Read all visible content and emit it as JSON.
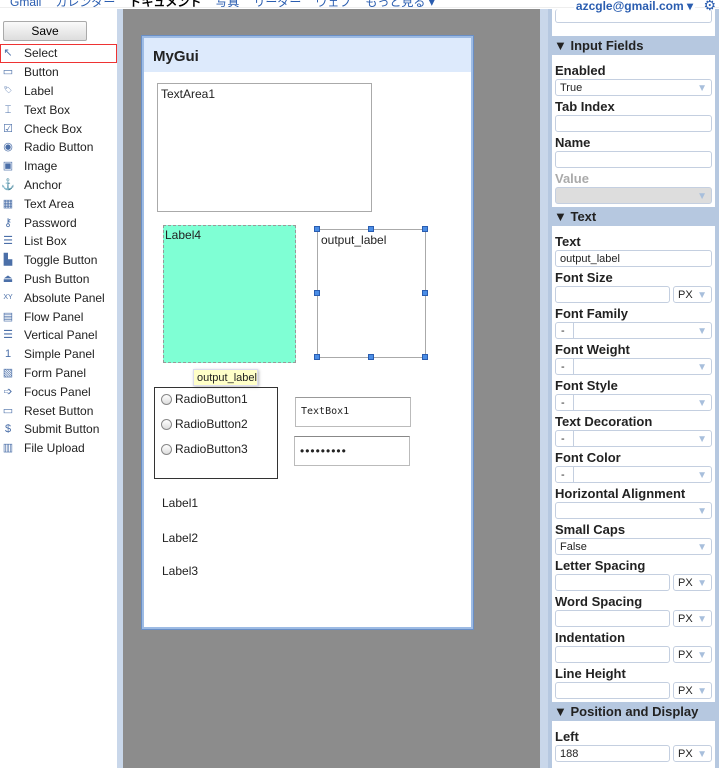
{
  "topbar": {
    "nav": [
      "Gmail",
      "カレンダー",
      "ドキュメント",
      "写真",
      "リーダー",
      "ウェブ",
      "もっと見る ▾"
    ],
    "current": "ドキュメント",
    "account": "azcgle@gmail.com ▾",
    "gear_icon": "gear-icon"
  },
  "palette": {
    "save_label": "Save",
    "items": [
      {
        "label": "Select",
        "icon": "cursor-icon",
        "glyph": "↖",
        "selected": true
      },
      {
        "label": "Button",
        "icon": "button-icon",
        "glyph": "▭"
      },
      {
        "label": "Label",
        "icon": "label-icon",
        "glyph": "🏷"
      },
      {
        "label": "Text Box",
        "icon": "text-box-icon",
        "glyph": "⌶"
      },
      {
        "label": "Check Box",
        "icon": "check-box-icon",
        "glyph": "☑"
      },
      {
        "label": "Radio Button",
        "icon": "radio-button-icon",
        "glyph": "◉"
      },
      {
        "label": "Image",
        "icon": "image-icon",
        "glyph": "▣"
      },
      {
        "label": "Anchor",
        "icon": "anchor-icon",
        "glyph": "⚓"
      },
      {
        "label": "Text Area",
        "icon": "text-area-icon",
        "glyph": "▦"
      },
      {
        "label": "Password",
        "icon": "key-icon",
        "glyph": "⚷"
      },
      {
        "label": "List Box",
        "icon": "list-box-icon",
        "glyph": "☰"
      },
      {
        "label": "Toggle Button",
        "icon": "toggle-button-icon",
        "glyph": "▙"
      },
      {
        "label": "Push Button",
        "icon": "push-button-icon",
        "glyph": "⏏"
      },
      {
        "label": "Absolute Panel",
        "icon": "absolute-panel-icon",
        "glyph": "XY"
      },
      {
        "label": "Flow Panel",
        "icon": "flow-panel-icon",
        "glyph": "▤"
      },
      {
        "label": "Vertical Panel",
        "icon": "vertical-panel-icon",
        "glyph": "☰"
      },
      {
        "label": "Simple Panel",
        "icon": "simple-panel-icon",
        "glyph": "1"
      },
      {
        "label": "Form Panel",
        "icon": "form-panel-icon",
        "glyph": "▧"
      },
      {
        "label": "Focus Panel",
        "icon": "focus-panel-icon",
        "glyph": "➩"
      },
      {
        "label": "Reset Button",
        "icon": "reset-button-icon",
        "glyph": "▭"
      },
      {
        "label": "Submit Button",
        "icon": "submit-button-icon",
        "glyph": "$"
      },
      {
        "label": "File Upload",
        "icon": "file-upload-icon",
        "glyph": "▥"
      }
    ]
  },
  "form": {
    "title": "MyGui",
    "textarea": "TextArea1",
    "label4": "Label4",
    "label4_color": "#7fffd4",
    "output_label": "output_label",
    "tooltip": "output_label",
    "radios": [
      "RadioButton1",
      "RadioButton2",
      "RadioButton3"
    ],
    "textbox": "TextBox1",
    "password": "•••••••••",
    "labels": [
      "Label1",
      "Label2",
      "Label3"
    ]
  },
  "props": {
    "sections": [
      {
        "title": "▼ Input Fields",
        "fields": [
          {
            "label": "Enabled",
            "type": "select",
            "value": "True"
          },
          {
            "label": "Tab Index",
            "type": "input",
            "value": ""
          },
          {
            "label": "Name",
            "type": "input",
            "value": ""
          },
          {
            "label": "Value",
            "type": "disabled",
            "value": ""
          }
        ]
      },
      {
        "title": "▼ Text",
        "fields": [
          {
            "label": "Text",
            "type": "input",
            "value": "output_label"
          },
          {
            "label": "Font Size",
            "type": "unit",
            "value": "",
            "unit": "PX"
          },
          {
            "label": "Font Family",
            "type": "dash",
            "value": "-"
          },
          {
            "label": "Font Weight",
            "type": "dash",
            "value": "-"
          },
          {
            "label": "Font Style",
            "type": "dash",
            "value": "-"
          },
          {
            "label": "Text Decoration",
            "type": "dash",
            "value": "-"
          },
          {
            "label": "Font Color",
            "type": "dash",
            "value": "-"
          },
          {
            "label": "Horizontal Alignment",
            "type": "select",
            "value": ""
          },
          {
            "label": "Small Caps",
            "type": "select",
            "value": "False"
          },
          {
            "label": "Letter Spacing",
            "type": "unit",
            "value": "",
            "unit": "PX"
          },
          {
            "label": "Word Spacing",
            "type": "unit",
            "value": "",
            "unit": "PX"
          },
          {
            "label": "Indentation",
            "type": "unit",
            "value": "",
            "unit": "PX"
          },
          {
            "label": "Line Height",
            "type": "unit",
            "value": "",
            "unit": "PX"
          }
        ]
      },
      {
        "title": "▼ Position and Display",
        "fields": [
          {
            "label": "Left",
            "type": "unit",
            "value": "188",
            "unit": "PX"
          }
        ]
      }
    ]
  }
}
